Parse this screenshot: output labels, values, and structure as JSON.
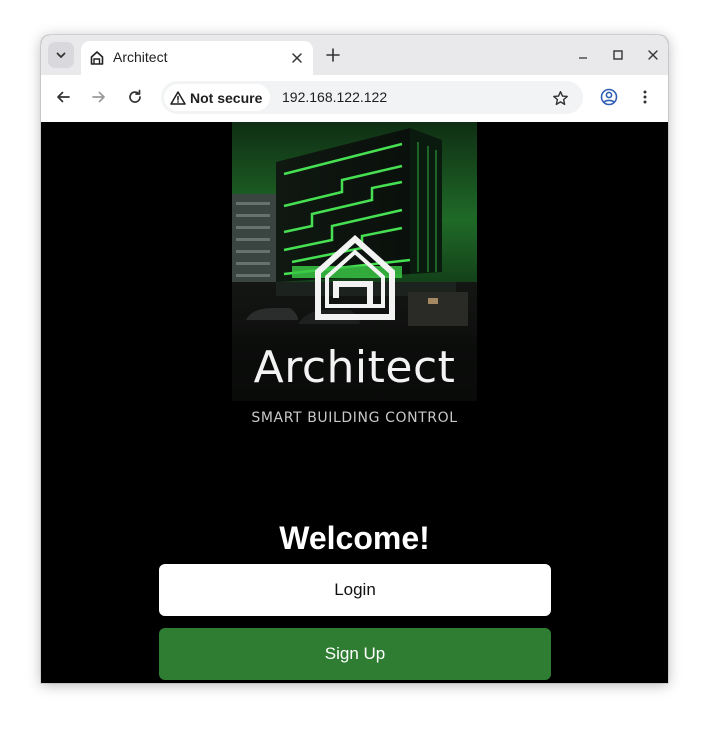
{
  "browser": {
    "tab": {
      "title": "Architect",
      "favicon": "house-icon"
    },
    "omnibox": {
      "security_label": "Not secure",
      "url": "192.168.122.122"
    },
    "icons": {
      "tab_search": "chevron-down-icon",
      "tab_close": "close-icon",
      "new_tab": "plus-icon",
      "minimize": "minimize-icon",
      "maximize": "maximize-icon",
      "close_window": "close-icon",
      "back": "arrow-left-icon",
      "forward": "arrow-right-icon",
      "reload": "reload-icon",
      "security": "warning-icon",
      "bookmark": "star-icon",
      "profile": "profile-icon",
      "menu": "kebab-menu-icon"
    }
  },
  "page": {
    "brand": {
      "name": "Architect",
      "logo_icon": "house-logo-icon"
    },
    "tagline": "SMART BUILDING CONTROL",
    "welcome": "Welcome!",
    "buttons": {
      "login": "Login",
      "signup": "Sign Up"
    },
    "colors": {
      "page_background": "#000000",
      "signup_button": "#2e7d32",
      "login_button": "#ffffff",
      "accent_green": "#3cd44a"
    }
  }
}
